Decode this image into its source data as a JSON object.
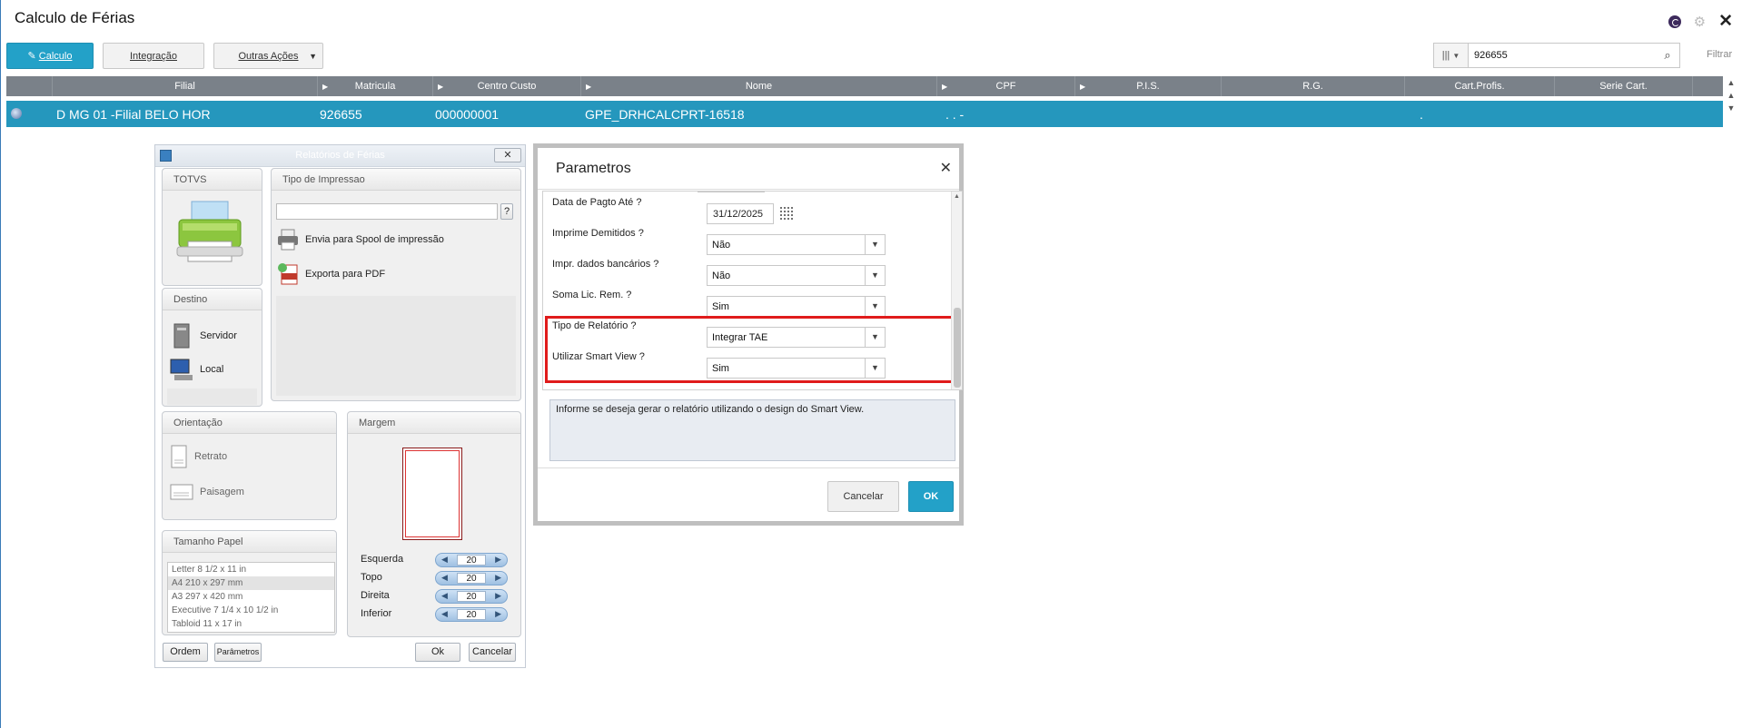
{
  "app": {
    "title": "Calculo de Férias"
  },
  "toolbar": {
    "calculo": "Calculo",
    "integracao": "Integração",
    "outras_acoes": "Outras Ações"
  },
  "search": {
    "value": "926655",
    "filter_label": "Filtrar"
  },
  "grid": {
    "columns": [
      "Filial",
      "Matricula",
      "Centro Custo",
      "Nome",
      "CPF",
      "P.I.S.",
      "R.G.",
      "Cart.Profis.",
      "Serie Cart."
    ],
    "row": {
      "filial": "D MG 01 -Filial BELO HOR",
      "matricula": "926655",
      "centro_custo": "000000001",
      "nome": "GPE_DRHCALCPRT-16518",
      "cpf": " .  .  -",
      "cart": "."
    }
  },
  "relatorio": {
    "title": "Relatórios de Férias",
    "totvs_label": "TOTVS",
    "tipo_impressao": "Tipo de Impressao",
    "help_btn": "?",
    "spool": "Envia para Spool de impressão",
    "pdf": "Exporta para PDF",
    "destino": "Destino",
    "servidor": "Servidor",
    "local": "Local",
    "orientacao": "Orientação",
    "retrato": "Retrato",
    "paisagem": "Paisagem",
    "margem": "Margem",
    "tamanho_papel": "Tamanho Papel",
    "papers": [
      "Letter 8 1/2 x 11 in",
      "A4 210 x 297 mm",
      "A3 297 x 420 mm",
      "Executive 7 1/4 x 10 1/2 in",
      "Tabloid 11 x 17 in"
    ],
    "margins": [
      {
        "label": "Esquerda",
        "value": "20"
      },
      {
        "label": "Topo",
        "value": "20"
      },
      {
        "label": "Direita",
        "value": "20"
      },
      {
        "label": "Inferior",
        "value": "20"
      }
    ],
    "ordem": "Ordem",
    "parametros": "Parâmetros",
    "ok": "Ok",
    "cancelar": "Cancelar"
  },
  "parametros": {
    "title": "Parametros",
    "close": "✕",
    "rows": [
      {
        "label": "Data de Pagto Até ?",
        "value": "31/12/2025"
      },
      {
        "label": "Imprime Demitidos ?",
        "value": "Não"
      },
      {
        "label": "Impr. dados bancários ?",
        "value": "Não"
      },
      {
        "label": "Soma Lic. Rem. ?",
        "value": "Sim"
      },
      {
        "label": "Tipo de Relatório ?",
        "value": "Integrar TAE"
      },
      {
        "label": "Utilizar Smart View ?",
        "value": "Sim"
      }
    ],
    "help_text": "Informe se deseja gerar o relatório utilizando o design do Smart View.",
    "cancel": "Cancelar",
    "ok": "OK"
  },
  "colors": {
    "accent": "#23a1c8",
    "selected_row": "#2597bd",
    "grid_header": "#7a8189",
    "highlight": "#e01b1b"
  }
}
